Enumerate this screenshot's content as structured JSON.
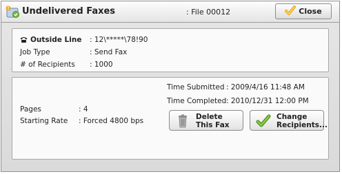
{
  "header": {
    "title": "Undelivered Faxes",
    "file_label": ": File 00012",
    "close_label": "Close"
  },
  "job": {
    "outside_line_label": "Outside Line",
    "outside_line_value": ": 12\\*****\\78!90",
    "job_type_label": "Job Type",
    "job_type_value": ": Send Fax",
    "recipients_label": "# of Recipients",
    "recipients_value": ": 1000"
  },
  "details": {
    "time_submitted_label": "Time Submitted",
    "time_submitted_value": ": 2009/4/16 11:48 AM",
    "time_completed_label": "Time Completed",
    "time_completed_value": ": 2010/12/31 12:00 PM",
    "pages_label": "Pages",
    "pages_value": ": 4",
    "starting_rate_label": "Starting Rate",
    "starting_rate_value": ": Forced 4800 bps"
  },
  "actions": {
    "delete_line1": "Delete",
    "delete_line2": "This Fax",
    "change_line1": "Change",
    "change_line2": "Recipients..."
  },
  "colors": {
    "check_green": "#6fb52c",
    "icon_orange": "#e9a21a"
  }
}
